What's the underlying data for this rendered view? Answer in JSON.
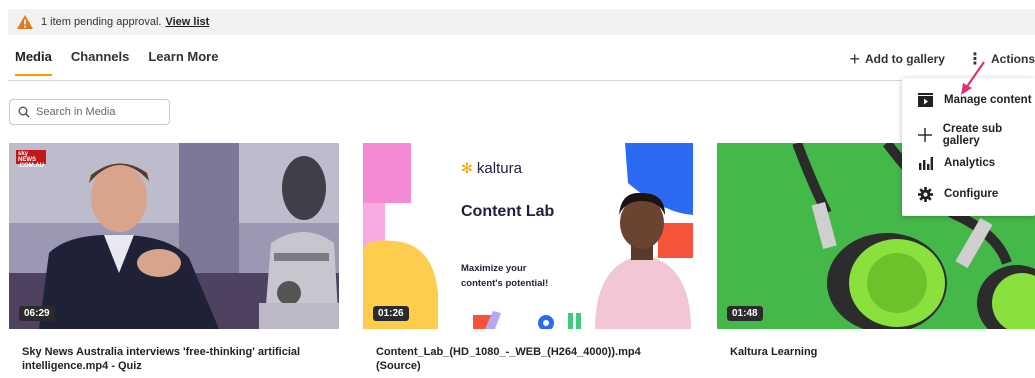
{
  "alert": {
    "message": "1 item pending approval.",
    "link_text": "View list",
    "icon": "warning-icon",
    "icon_color": "#e07a1f"
  },
  "tabs": [
    {
      "label": "Media",
      "active": true
    },
    {
      "label": "Channels",
      "active": false
    },
    {
      "label": "Learn More",
      "active": false
    }
  ],
  "accent_color": "#f0a100",
  "toolbar": {
    "add_label": "Add to gallery",
    "actions_label": "Actions"
  },
  "search": {
    "placeholder": "Search in Media",
    "value": ""
  },
  "media": [
    {
      "duration": "06:29",
      "title": "Sky News Australia interviews 'free-thinking' artificial intelligence.mp4 - Quiz",
      "logo_text": "sky NEWS .COM.AU"
    },
    {
      "duration": "01:26",
      "title": "Content_Lab_(HD_1080_-_WEB_(H264_4000)).mp4 (Source)",
      "brand": "kaltura",
      "headline": "Content Lab",
      "tagline_1": "Maximize your",
      "tagline_2": "content's potential!"
    },
    {
      "duration": "01:48",
      "title": "Kaltura Learning"
    }
  ],
  "actions_menu": [
    {
      "label": "Manage content",
      "icon": "play-box-icon"
    },
    {
      "label": "Create sub gallery",
      "icon": "plus-icon"
    },
    {
      "label": "Analytics",
      "icon": "bar-chart-icon"
    },
    {
      "label": "Configure",
      "icon": "gear-icon"
    }
  ],
  "annotation_arrow_color": "#e0307a"
}
